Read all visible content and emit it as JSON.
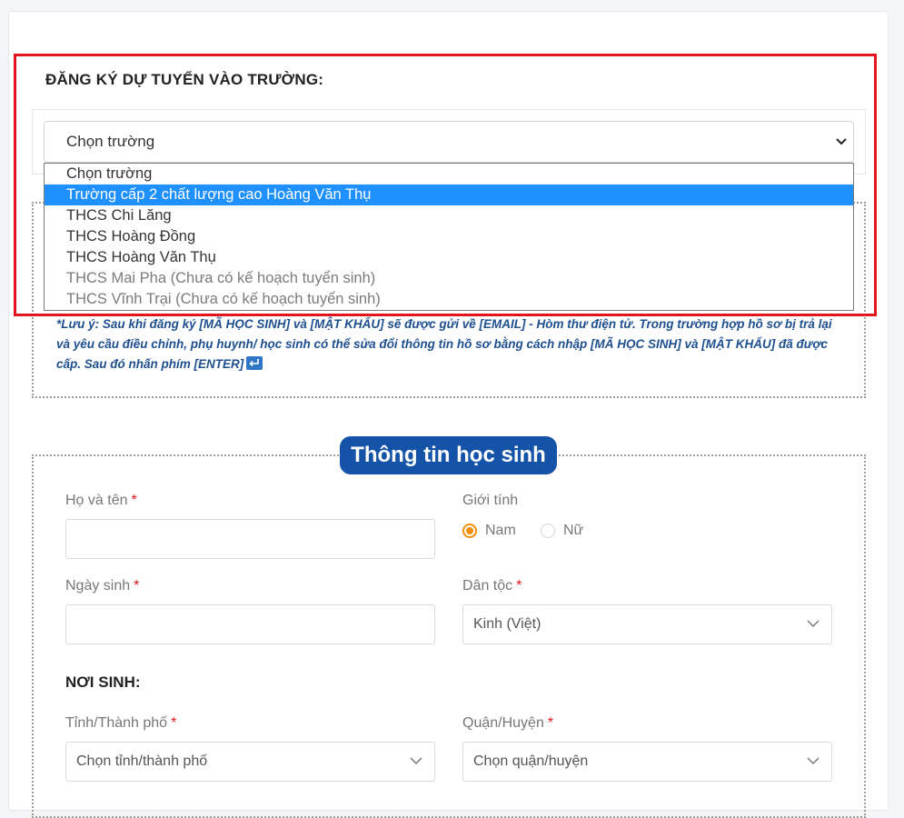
{
  "register": {
    "title": "ĐĂNG KÝ DỰ TUYỂN VÀO TRƯỜNG:",
    "selected": "Chọn trường",
    "options": [
      {
        "label": "Chọn trường",
        "state": "normal"
      },
      {
        "label": "Trường cấp 2 chất lượng cao Hoàng Văn Thụ",
        "state": "highlighted"
      },
      {
        "label": "THCS Chi Lăng",
        "state": "normal"
      },
      {
        "label": "THCS Hoàng Đồng",
        "state": "normal"
      },
      {
        "label": "THCS Hoàng Văn Thụ",
        "state": "normal"
      },
      {
        "label": "THCS Mai Pha (Chưa có kế hoạch tuyển sinh)",
        "state": "disabled"
      },
      {
        "label": "THCS Vĩnh Trại (Chưa có kế hoạch tuyển sinh)",
        "state": "disabled"
      }
    ],
    "note": "*Lưu ý: Sau khi đăng ký [MÃ HỌC SINH] và [MẬT KHẨU] sẽ được gửi về [EMAIL] - Hòm thư điện tử. Trong trường hợp hồ sơ bị trả lại và yêu cầu điều chỉnh, phụ huynh/ học sinh có thể sửa đổi thông tin hồ sơ bằng cách nhập [MÃ HỌC SINH] và [MẬT KHẨU] đã được cấp. Sau đó nhấn phím [ENTER]"
  },
  "student": {
    "section_title": "Thông tin học sinh",
    "fullname_label": "Họ và tên",
    "gender_label": "Giới tính",
    "gender_options": [
      "Nam",
      "Nữ"
    ],
    "gender_selected": "Nam",
    "dob_label": "Ngày sinh",
    "ethnicity_label": "Dân tộc",
    "ethnicity_value": "Kinh (Việt)",
    "birthplace_heading": "NƠI SINH:",
    "province_label": "Tỉnh/Thành phố",
    "province_placeholder": "Chọn tỉnh/thành phố",
    "district_label": "Quận/Huyện",
    "district_placeholder": "Chọn quận/huyện",
    "required_mark": "*"
  },
  "colors": {
    "highlight_border": "#e3141b",
    "section_pill": "#1553a8",
    "note_text": "#1e4f8f",
    "option_highlight": "#1e90ff",
    "radio_active": "#f0900b"
  }
}
